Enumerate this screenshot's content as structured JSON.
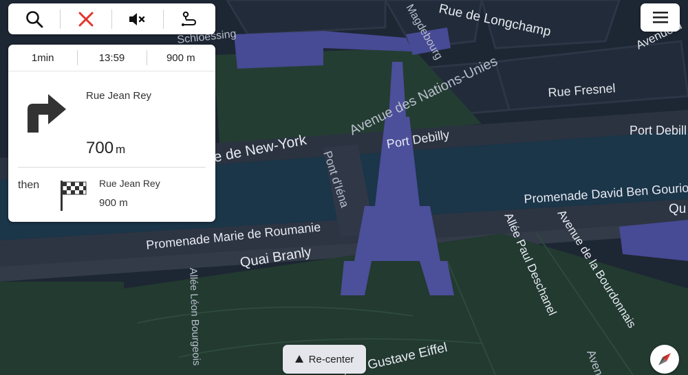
{
  "toolbar": {
    "search_icon": "search-icon",
    "close_icon": "close-icon",
    "mute_icon": "volume-mute-icon",
    "route_icon": "route-options-icon"
  },
  "menu_icon": "menu-icon",
  "summary": {
    "time": "1min",
    "eta": "13:59",
    "distance": "900 m"
  },
  "maneuver": {
    "icon": "turn-right-icon",
    "street": "Rue Jean Rey",
    "distance_value": "700",
    "distance_unit": "m"
  },
  "then": {
    "label": "then",
    "icon": "checkered-flag-icon",
    "street": "Rue Jean Rey",
    "distance": "900 m"
  },
  "recenter": {
    "label": "Re-center"
  },
  "compass_icon": "compass-icon",
  "map": {
    "labels": {
      "rue_de_longchamp": "Rue de Longchamp",
      "avenue_top_right": "Avenue d",
      "avenue_des_nations_unies": "Avenue des Nations-Unies",
      "rue_fresnel": "Rue Fresnel",
      "port_debilly_right": "Port Debill",
      "port_debilly": "Port Debilly",
      "de_new_york": "e de New-York",
      "pont_diena": "Pont d'Iéna",
      "promenade_david_ben_gourion": "Promenade David Ben Gourio",
      "qu_right": "Qu",
      "promenade_marie_de_roumanie": "Promenade Marie de Roumanie",
      "quai_branly": "Quai Branly",
      "allee_paul_deschanel": "Allée Paul Deschanel",
      "avenue_de_la_bourdonnais": "Avenue de la Bourdonnais",
      "allee_leon_bourgeois": "Allée Léon Bourgeois",
      "avenue_gustave_eiffel": "nue Gustave Eiffel",
      "magdebourg": "Magdebourg",
      "schloessing": "Schloessing",
      "aven_bottom": "Aven"
    },
    "colors": {
      "city": "#1d2633",
      "park": "#243d33",
      "water": "#1b3549",
      "road": "#2e3644",
      "tower": "#4c4f9a",
      "building": "#474a94"
    }
  }
}
